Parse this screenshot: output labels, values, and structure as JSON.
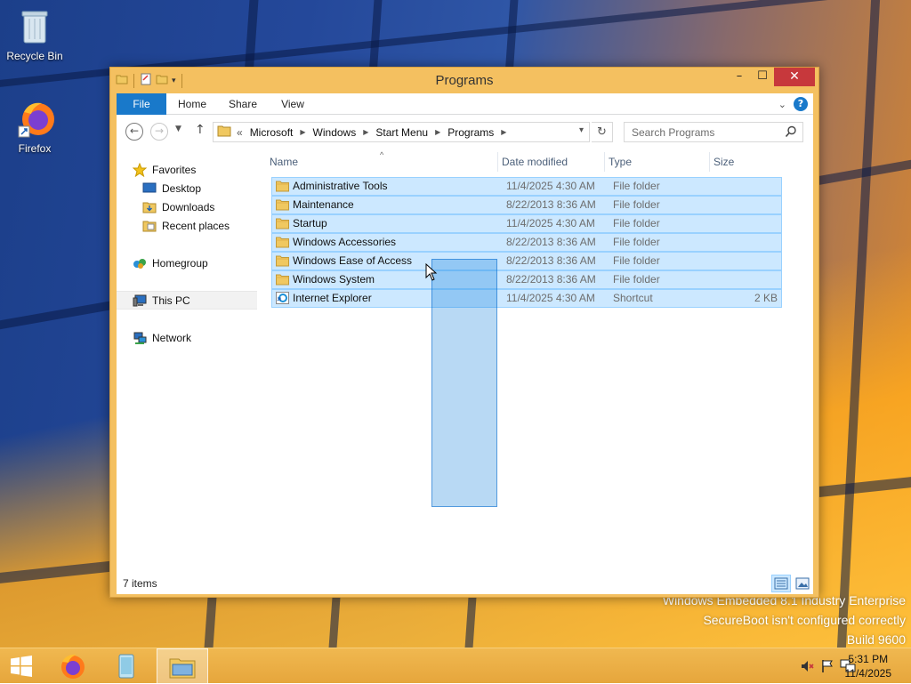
{
  "desktop": {
    "icons": [
      {
        "label": "Recycle Bin",
        "icon": "recycle-bin-icon"
      },
      {
        "label": "Firefox",
        "icon": "firefox-icon"
      }
    ],
    "watermark": {
      "line1": "Windows Embedded 8.1 Industry Enterprise",
      "line2": "SecureBoot isn't configured correctly",
      "line3": "Build 9600"
    }
  },
  "window": {
    "title": "Programs",
    "controls": {
      "minimize": "–",
      "maximize": "☐",
      "close": "✕"
    },
    "ribbon_tabs": [
      "File",
      "Home",
      "Share",
      "View"
    ],
    "address": {
      "overflow": "«",
      "crumbs": [
        "Microsoft",
        "Windows",
        "Start Menu",
        "Programs"
      ]
    },
    "search": {
      "placeholder": "Search Programs"
    },
    "nav_pane": {
      "favorites": "Favorites",
      "desktop": "Desktop",
      "downloads": "Downloads",
      "recent_places": "Recent places",
      "homegroup": "Homegroup",
      "this_pc": "This PC",
      "network": "Network"
    },
    "columns": {
      "name": "Name",
      "date": "Date modified",
      "type": "Type",
      "size": "Size"
    },
    "files": [
      {
        "name": "Administrative Tools",
        "date": "11/4/2025 4:30 AM",
        "type": "File folder",
        "size": ""
      },
      {
        "name": "Maintenance",
        "date": "8/22/2013 8:36 AM",
        "type": "File folder",
        "size": ""
      },
      {
        "name": "Startup",
        "date": "11/4/2025 4:30 AM",
        "type": "File folder",
        "size": ""
      },
      {
        "name": "Windows Accessories",
        "date": "8/22/2013 8:36 AM",
        "type": "File folder",
        "size": ""
      },
      {
        "name": "Windows Ease of Access",
        "date": "8/22/2013 8:36 AM",
        "type": "File folder",
        "size": ""
      },
      {
        "name": "Windows System",
        "date": "8/22/2013 8:36 AM",
        "type": "File folder",
        "size": ""
      },
      {
        "name": "Internet Explorer",
        "date": "11/4/2025 4:30 AM",
        "type": "Shortcut",
        "size": "2 KB"
      }
    ],
    "status": "7 items"
  },
  "taskbar": {
    "clock_time": "5:31 PM",
    "clock_date": "11/4/2025"
  },
  "colors": {
    "accent": "#1979ca",
    "selection": "#cce8ff",
    "window_frame": "#f4c060",
    "close_button": "#c7383c"
  }
}
